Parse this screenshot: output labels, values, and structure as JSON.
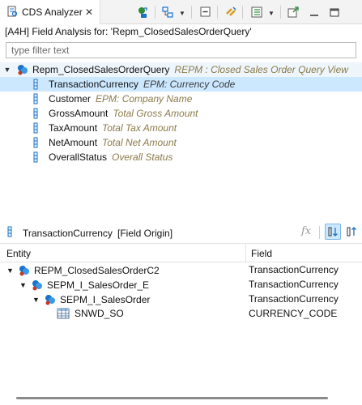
{
  "tab": {
    "label": "CDS Analyzer",
    "close": "✕"
  },
  "heading": "[A4H] Field Analysis for: 'Repm_ClosedSalesOrderQuery'",
  "filter": {
    "placeholder": "type filter text",
    "value": ""
  },
  "tree": {
    "root": {
      "name": "Repm_ClosedSalesOrderQuery",
      "desc": "REPM : Closed Sales Order Query View"
    },
    "fields": [
      {
        "name": "TransactionCurrency",
        "desc": "EPM: Currency Code",
        "selected": true
      },
      {
        "name": "Customer",
        "desc": "EPM: Company Name"
      },
      {
        "name": "GrossAmount",
        "desc": "Total Gross Amount"
      },
      {
        "name": "TaxAmount",
        "desc": "Total Tax Amount"
      },
      {
        "name": "NetAmount",
        "desc": "Total Net Amount"
      },
      {
        "name": "OverallStatus",
        "desc": "Overall Status"
      }
    ]
  },
  "origin": {
    "field": "TransactionCurrency",
    "tag": "[Field Origin]",
    "fx": "fx"
  },
  "table": {
    "headers": {
      "entity": "Entity",
      "field": "Field"
    },
    "rows": [
      {
        "entity": "REPM_ClosedSalesOrderC2",
        "field": "TransactionCurrency",
        "level": 0,
        "kind": "view"
      },
      {
        "entity": "SEPM_I_SalesOrder_E",
        "field": "TransactionCurrency",
        "level": 1,
        "kind": "view"
      },
      {
        "entity": "SEPM_I_SalesOrder",
        "field": "TransactionCurrency",
        "level": 2,
        "kind": "view"
      },
      {
        "entity": "SNWD_SO",
        "field": "CURRENCY_CODE",
        "level": 3,
        "kind": "table"
      }
    ]
  },
  "colors": {
    "selection": "#cce8ff",
    "description": "#8a7a4a",
    "accent": "#1a73c9"
  }
}
